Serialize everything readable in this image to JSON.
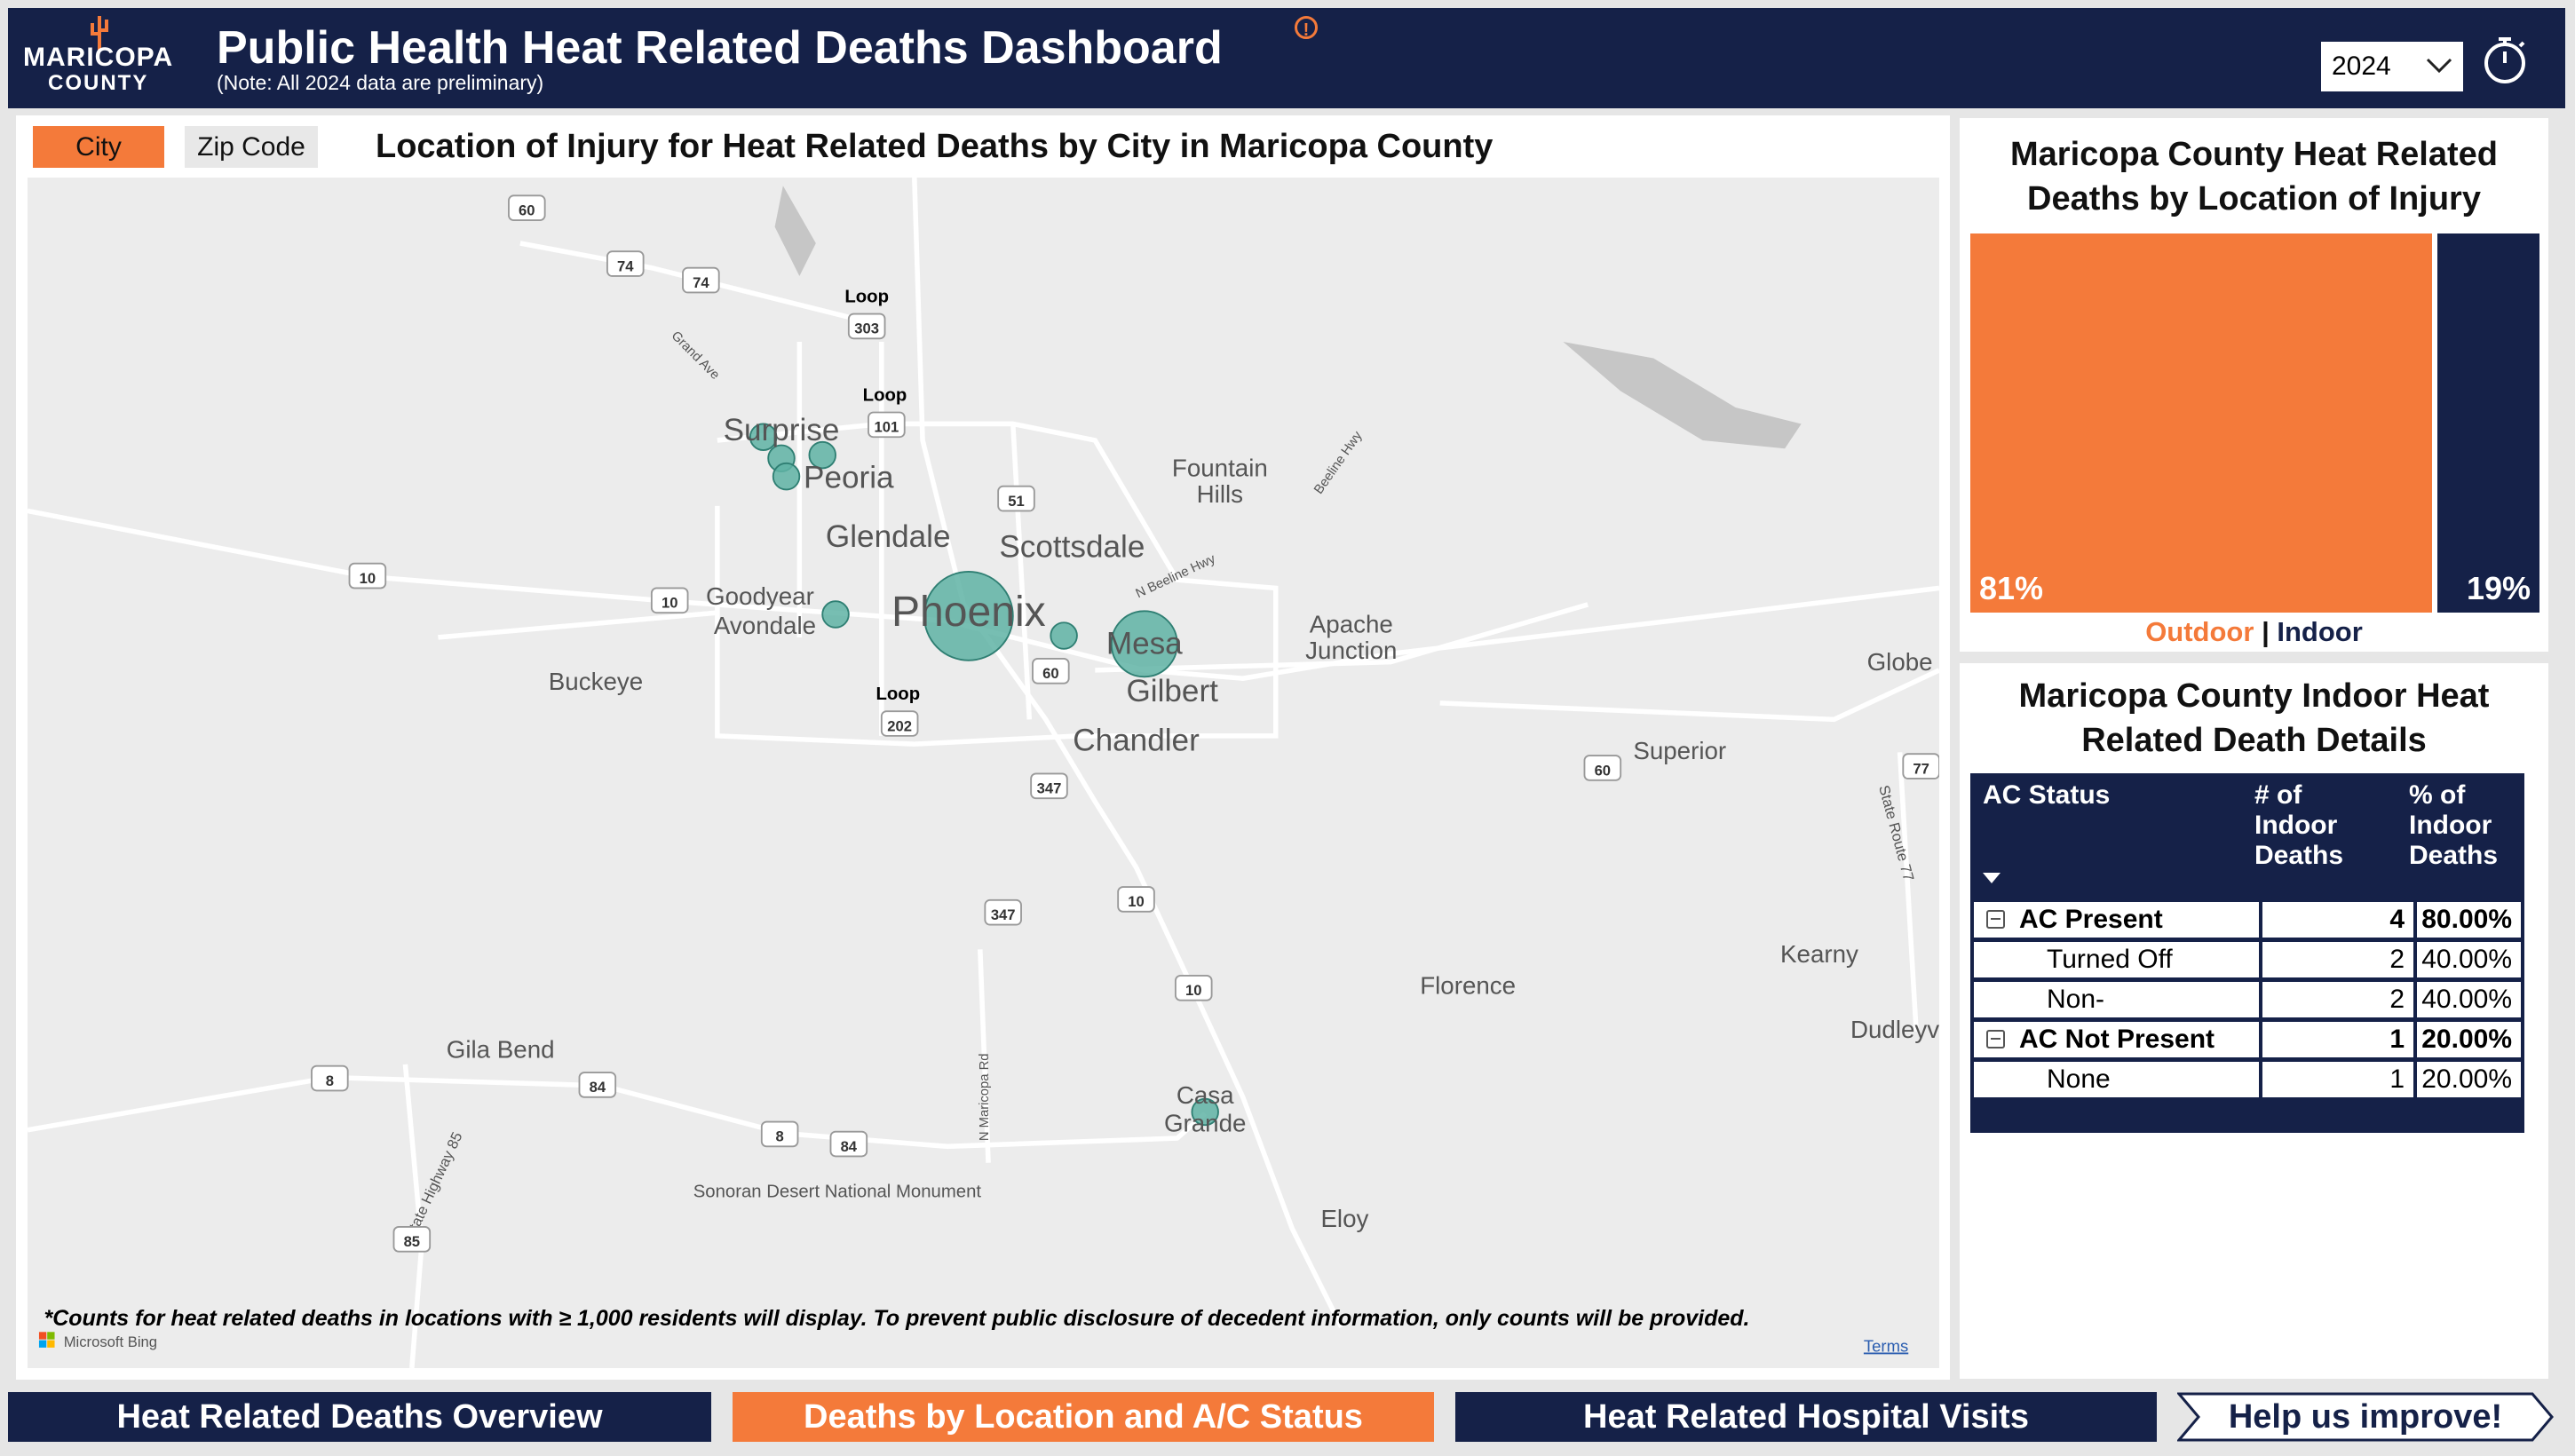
{
  "header": {
    "logo_text_1": "MARICOPA",
    "logo_text_2": "COUNTY",
    "title": "Public Health Heat Related Deaths Dashboard",
    "note": "(Note: All 2024 data are preliminary)",
    "year": "2024",
    "info_icon": "info-icon",
    "timer_icon": "stopwatch-icon"
  },
  "colors": {
    "navy": "#152148",
    "orange": "#f47a3a",
    "bubble": "#5fb3a5"
  },
  "map_panel": {
    "toggle": [
      "City",
      "Zip Code"
    ],
    "selected_toggle": "City",
    "title": "Location of Injury for Heat Related Deaths by City in Maricopa County",
    "cities": [
      "Surprise",
      "Peoria",
      "Glendale",
      "Scottsdale",
      "Fountain",
      "Hills",
      "Goodyear",
      "Avondale",
      "Phoenix",
      "Mesa",
      "Gilbert",
      "Chandler",
      "Apache",
      "Junction",
      "Buckeye",
      "Globe",
      "Superior",
      "Kearny",
      "Florence",
      "Dudleyv",
      "Gila Bend",
      "Casa",
      "Grande",
      "Eloy",
      "Sonoran Desert National Monument"
    ],
    "roads": [
      "Grand Ave",
      "Beeline Hwy",
      "N Beeline Hwy",
      "State Highway 85",
      "N Maricopa Rd",
      "State Route 77"
    ],
    "loop": "Loop",
    "shields": [
      "60",
      "74",
      "74",
      "303",
      "101",
      "51",
      "10",
      "10",
      "60",
      "202",
      "347",
      "347",
      "10",
      "10",
      "60",
      "77",
      "8",
      "8",
      "84",
      "84",
      "85"
    ],
    "footnote": "*Counts for heat related deaths in locations with ≥ 1,000 residents will display. To prevent public disclosure of decedent information, only counts will be provided.",
    "attribution": "Microsoft Bing",
    "terms": "Terms"
  },
  "location_panel": {
    "title_1": "Maricopa County Heat Related",
    "title_2": "Deaths by Location of Injury",
    "segments": [
      {
        "label": "Outdoor",
        "percent": "81%",
        "value": 81,
        "color": "#f47a3a"
      },
      {
        "label": "Indoor",
        "percent": "19%",
        "value": 19,
        "color": "#152148"
      }
    ],
    "legend_sep": "|"
  },
  "indoor_panel": {
    "title_1": "Maricopa County Indoor Heat",
    "title_2": "Related Death Details",
    "columns": [
      "AC Status",
      "# of Indoor Deaths",
      "% of Indoor Deaths"
    ],
    "col2_lines": [
      "# of",
      "Indoor",
      "Deaths"
    ],
    "col3_lines": [
      "% of",
      "Indoor",
      "Deaths"
    ],
    "rows": [
      {
        "label": "AC Present",
        "count": "4",
        "pct": "80.00%",
        "level": 0
      },
      {
        "label": "Turned Off",
        "count": "2",
        "pct": "40.00%",
        "level": 1
      },
      {
        "label": "Non-",
        "count": "2",
        "pct": "40.00%",
        "level": 1
      },
      {
        "label": "AC Not Present",
        "count": "1",
        "pct": "20.00%",
        "level": 0
      },
      {
        "label": "None",
        "count": "1",
        "pct": "20.00%",
        "level": 1
      }
    ]
  },
  "nav": {
    "items": [
      "Heat Related Deaths Overview",
      "Deaths by Location and A/C Status",
      "Heat Related Hospital Visits",
      "Help us improve!"
    ],
    "active": "Deaths by Location and A/C Status"
  }
}
